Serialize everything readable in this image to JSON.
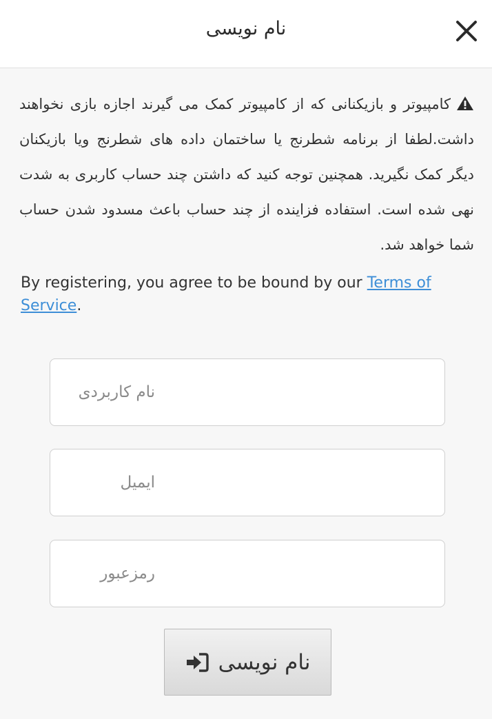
{
  "header": {
    "title": "نام نویسی",
    "close_icon": "close-icon"
  },
  "warning": {
    "icon": "warning-triangle-icon",
    "text": "کامپیوتر و بازیکنانی که از کامپیوتر کمک می گیرند اجازه بازی نخواهند داشت.لطفا از برنامه شطرنج یا ساختمان داده های شطرنج ویا بازیکنان دیگر کمک نگیرید. همچنین توجه کنید که داشتن چند حساب کاربری به شدت نهی شده است. استفاده فزاینده از چند حساب باعث مسدود شدن حساب شما خواهد شد."
  },
  "terms": {
    "prefix": "By registering, you agree to be bound by our ",
    "link_text": "Terms of Service",
    "suffix": ".",
    "link_color": "#3d8ed7"
  },
  "form": {
    "username_placeholder": "نام کاربردی",
    "email_placeholder": "ایمیل",
    "password_placeholder": "رمزعبور",
    "submit_label": "نام نویسی",
    "submit_icon": "sign-in-icon"
  }
}
